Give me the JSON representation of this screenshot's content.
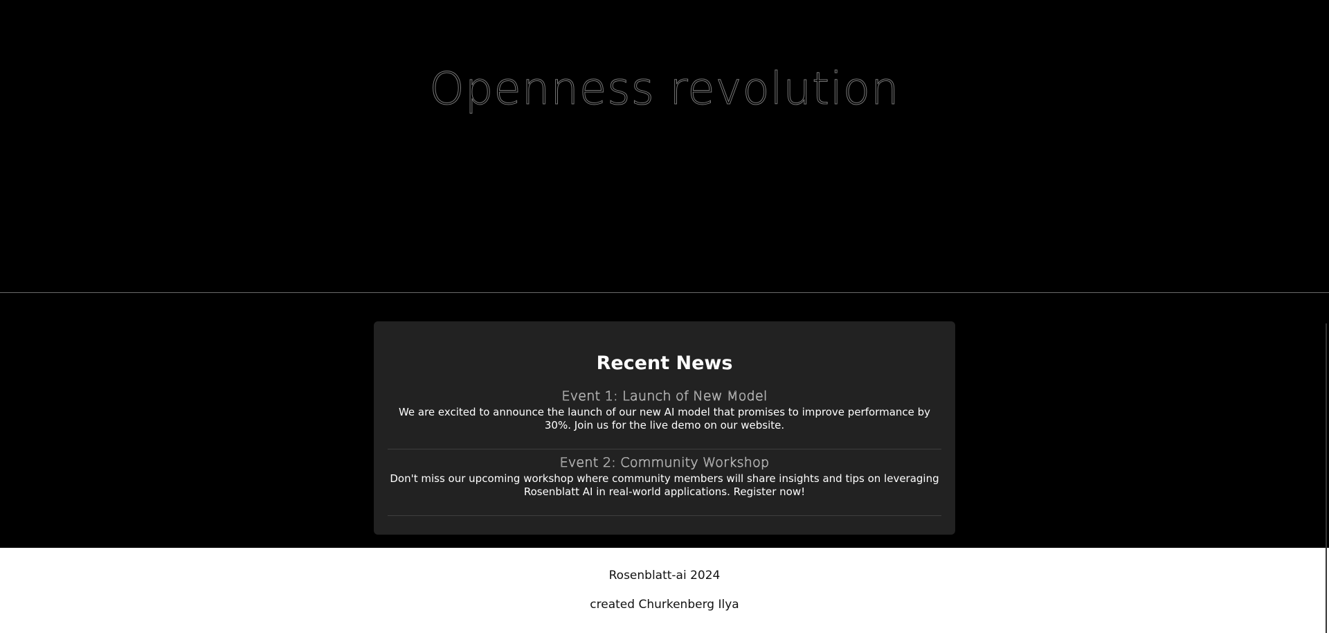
{
  "hero": {
    "title": "Openness revolution"
  },
  "news": {
    "heading": "Recent News",
    "items": [
      {
        "title": "Event 1: Launch of New Model",
        "body": "We are excited to announce the launch of our new AI model that promises to improve performance by 30%. Join us for the live demo on our website."
      },
      {
        "title": "Event 2: Community Workshop",
        "body": "Don't miss our upcoming workshop where community members will share insights and tips on leveraging Rosenblatt AI in real-world applications. Register now!"
      }
    ]
  },
  "footer": {
    "copyright": "Rosenblatt-ai 2024",
    "credit": "created Churkenberg Ilya"
  },
  "colors": {
    "background": "#000000",
    "card": "#222222",
    "footer": "#ffffff"
  }
}
